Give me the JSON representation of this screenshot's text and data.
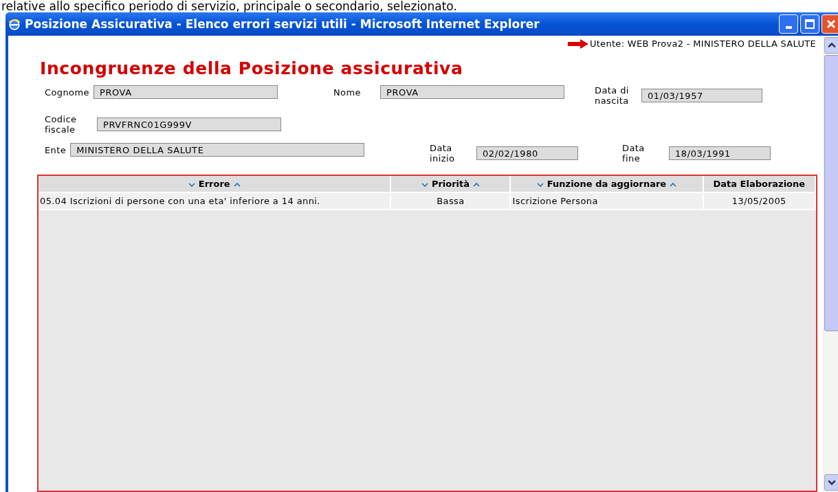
{
  "intro_text": "relative allo specifico periodo di servizio, principale o secondario, selezionato.",
  "window": {
    "title": "Posizione Assicurativa - Elenco errori servizi utili - Microsoft Internet Explorer"
  },
  "user_line": "Utente: WEB Prova2 - MINISTERO DELLA SALUTE",
  "heading": "Incongruenze della Posizione assicurativa",
  "fields": [
    {
      "label": "Cognome",
      "value": "PROVA"
    },
    {
      "label": "Nome",
      "value": "PROVA"
    },
    {
      "label": "Data di nascita",
      "value": "01/03/1957"
    },
    {
      "label": "Codice fiscale",
      "value": "PRVFRNC01G999V"
    },
    {
      "label": "Ente",
      "value": "MINISTERO DELLA SALUTE"
    },
    {
      "label": "Data inizio",
      "value": "02/02/1980"
    },
    {
      "label": "Data fine",
      "value": "18/03/1991"
    }
  ],
  "table": {
    "columns": [
      {
        "label": "Errore",
        "sortable": true
      },
      {
        "label": "Priorità",
        "sortable": true
      },
      {
        "label": "Funzione da aggiornare",
        "sortable": true
      },
      {
        "label": "Data Elaborazione",
        "sortable": false
      }
    ],
    "rows": [
      [
        "05.04 Iscrizioni di persone con una eta' inferiore a 14 anni.",
        "Bassa",
        "Iscrizione Persona",
        "13/05/2005"
      ]
    ]
  }
}
